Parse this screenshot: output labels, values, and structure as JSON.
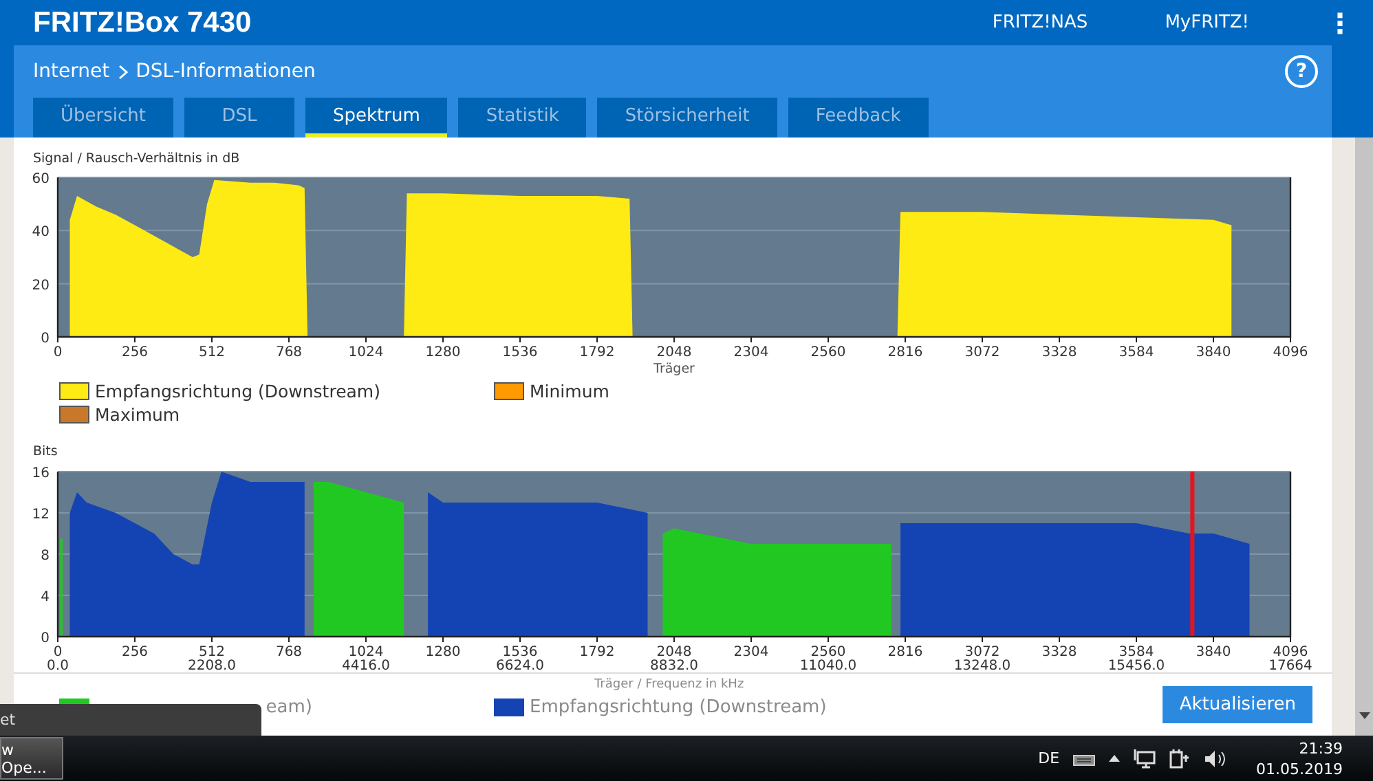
{
  "header": {
    "title": "FRITZ!Box 7430",
    "links": [
      "FRITZ!NAS",
      "MyFRITZ!"
    ],
    "menu_icon": "⋮"
  },
  "panel": {
    "breadcrumb": [
      {
        "label": "Internet"
      },
      {
        "label": "DSL-Informationen"
      }
    ],
    "help": "?",
    "tabs": [
      {
        "label": "Übersicht",
        "selected": false
      },
      {
        "label": "DSL",
        "selected": false
      },
      {
        "label": "Spektrum",
        "selected": true
      },
      {
        "label": "Statistik",
        "selected": false
      },
      {
        "label": "Störsicherheit",
        "selected": false
      },
      {
        "label": "Feedback",
        "selected": false
      }
    ]
  },
  "snr_chart": {
    "chart_data": {
      "type": "area",
      "ylabel": "Signal / Rausch-Verhältnis in dB",
      "xlabel": "Träger",
      "xlim": [
        0,
        4096
      ],
      "ylim": [
        0,
        60
      ],
      "yticks": [
        0,
        20,
        40,
        60
      ],
      "grid": true,
      "xticks": [
        0,
        256,
        512,
        768,
        1024,
        1280,
        1536,
        1792,
        2048,
        2304,
        2560,
        2816,
        3072,
        3328,
        3584,
        3840,
        4096
      ],
      "x": [
        40,
        64,
        128,
        192,
        256,
        320,
        384,
        448,
        470,
        496,
        520,
        640,
        720,
        800,
        820,
        830,
        1150,
        1160,
        1280,
        1536,
        1792,
        1900,
        1910,
        2790,
        2800,
        3072,
        3328,
        3584,
        3840,
        3900
      ],
      "series": [
        {
          "name": "Empfangsrichtung (Downstream)",
          "color": "#ffeb14",
          "values": [
            44,
            53,
            49,
            46,
            42,
            38,
            34,
            30,
            31,
            50,
            59,
            58,
            58,
            57,
            56,
            0,
            0,
            54,
            54,
            53,
            53,
            52,
            0,
            0,
            47,
            47,
            46,
            45,
            44,
            42
          ]
        },
        {
          "name": "Minimum",
          "color": "#ff9a00",
          "values": [
            null,
            null,
            null,
            null,
            null,
            null,
            null,
            null,
            null,
            null,
            null,
            null,
            null,
            null,
            null,
            null,
            null,
            null,
            null,
            null,
            null,
            null,
            null,
            null,
            null,
            null,
            null,
            null,
            null,
            null
          ]
        },
        {
          "name": "Maximum",
          "color": "#c87828",
          "values": [
            null,
            null,
            null,
            null,
            null,
            null,
            null,
            null,
            null,
            null,
            null,
            null,
            null,
            null,
            null,
            null,
            null,
            null,
            null,
            null,
            null,
            null,
            null,
            null,
            null,
            null,
            null,
            null,
            null,
            null
          ]
        }
      ]
    }
  },
  "bits_chart": {
    "chart_data": {
      "type": "area",
      "ylabel": "Bits",
      "xlabel": "Träger / Frequenz in kHz",
      "xlim": [
        0,
        4096
      ],
      "ylim": [
        0,
        16
      ],
      "yticks": [
        0,
        4,
        8,
        12,
        16
      ],
      "grid": true,
      "xticks": [
        0,
        256,
        512,
        768,
        1024,
        1280,
        1536,
        1792,
        2048,
        2304,
        2560,
        2816,
        3072,
        3328,
        3584,
        3840,
        4096
      ],
      "x": [
        8,
        16,
        40,
        64,
        96,
        192,
        256,
        320,
        384,
        448,
        470,
        512,
        544,
        640,
        820,
        850,
        900,
        1024,
        1150,
        1230,
        1280,
        1792,
        1960,
        2010,
        2048,
        2304,
        2770,
        2800,
        3072,
        3584,
        3760,
        3780,
        3840,
        3960
      ],
      "series": [
        {
          "name": "eam)",
          "color": "#22c822",
          "values": [
            9.5,
            9.5,
            null,
            null,
            null,
            null,
            null,
            null,
            null,
            null,
            null,
            null,
            null,
            null,
            null,
            15,
            15,
            14,
            13,
            null,
            null,
            null,
            null,
            10,
            10.5,
            9,
            9,
            null,
            null,
            null,
            null,
            null,
            null,
            null
          ]
        },
        {
          "name": "Empfangsrichtung (Downstream)",
          "color": "#1444b4",
          "values": [
            null,
            null,
            12,
            14,
            13,
            12,
            11,
            10,
            8,
            7,
            7,
            13,
            16,
            15,
            15,
            null,
            null,
            null,
            null,
            14,
            13,
            13,
            12,
            null,
            null,
            null,
            null,
            11,
            11,
            11,
            10,
            10,
            10,
            9
          ]
        }
      ],
      "ref_lines": [
        {
          "axis": "x",
          "value": 3770,
          "color": "#e8141c"
        }
      ]
    },
    "frequency_labels": [
      "0.0",
      "2208.0",
      "4416.0",
      "6624.0",
      "8832.0",
      "11040.0",
      "13248.0",
      "15456.0",
      "17664"
    ]
  },
  "refresh_button": "Aktualisieren",
  "tooltip": "et",
  "taskbar": {
    "window_button": "w Ope...",
    "language": "DE",
    "time": "21:39",
    "date": "01.05.2019"
  }
}
